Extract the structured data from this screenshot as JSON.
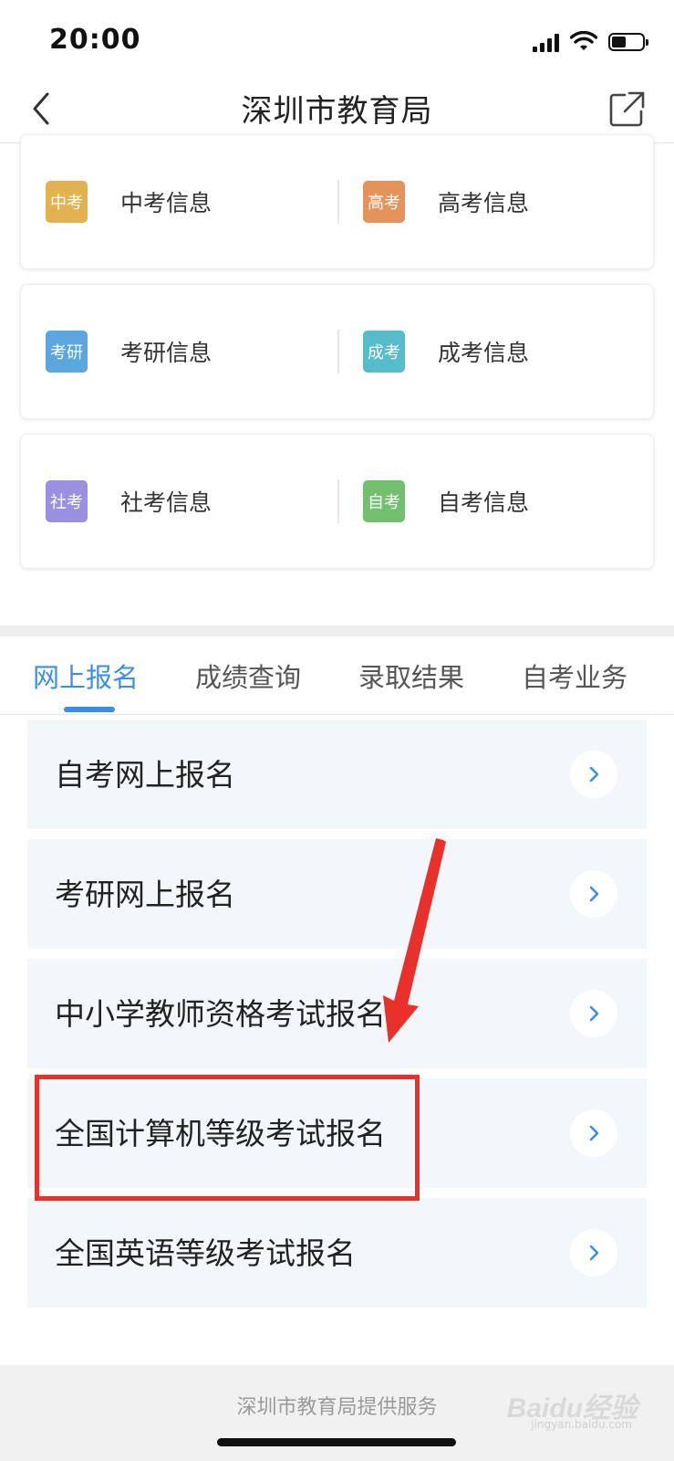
{
  "status_bar": {
    "time": "20:00"
  },
  "nav": {
    "title": "深圳市教育局",
    "back_icon": "chevron-left-icon",
    "share_icon": "share-icon"
  },
  "info_cards": [
    {
      "left": {
        "badge": "中考",
        "label": "中考信息",
        "color": "#e2b24f"
      },
      "right": {
        "badge": "高考",
        "label": "高考信息",
        "color": "#e4935a"
      }
    },
    {
      "left": {
        "badge": "考研",
        "label": "考研信息",
        "color": "#5aa6dd"
      },
      "right": {
        "badge": "成考",
        "label": "成考信息",
        "color": "#56bccb"
      }
    },
    {
      "left": {
        "badge": "社考",
        "label": "社考信息",
        "color": "#9a8fe0"
      },
      "right": {
        "badge": "自考",
        "label": "自考信息",
        "color": "#72bf6e"
      }
    }
  ],
  "tabs": [
    {
      "label": "网上报名",
      "active": true
    },
    {
      "label": "成绩查询",
      "active": false
    },
    {
      "label": "录取结果",
      "active": false
    },
    {
      "label": "自考业务",
      "active": false
    }
  ],
  "list_items": [
    {
      "label": "自考网上报名"
    },
    {
      "label": "考研网上报名"
    },
    {
      "label": "中小学教师资格考试报名"
    },
    {
      "label": "全国计算机等级考试报名"
    },
    {
      "label": "全国英语等级考试报名"
    }
  ],
  "footer": {
    "text": "深圳市教育局提供服务",
    "watermark": "Baidu经验",
    "watermark_sub": "jingyan.baidu.com"
  },
  "colors": {
    "accent": "#3a8ee6",
    "annotation": "#e8312b",
    "list_bg": "#f3f7fb"
  }
}
